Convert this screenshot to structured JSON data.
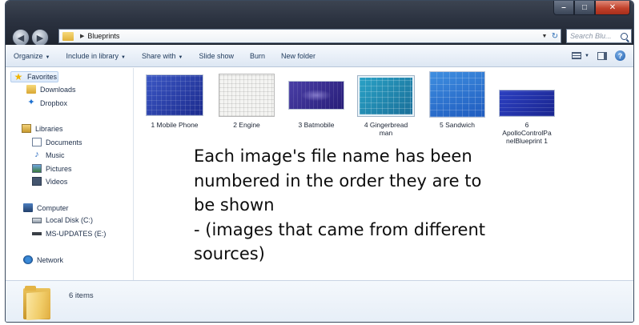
{
  "window": {
    "buttons": {
      "minimize": "–",
      "maximize": "□",
      "close": "✕"
    }
  },
  "address_bar": {
    "location": "Blueprints",
    "search_placeholder": "Search Blu..."
  },
  "nav_buttons": {
    "back": "◀",
    "forward": "▶"
  },
  "command_bar": {
    "organize": "Organize",
    "include_in_library": "Include in library",
    "share_with": "Share with",
    "slide_show": "Slide show",
    "burn": "Burn",
    "new_folder": "New folder",
    "help": "?"
  },
  "navigation": {
    "favorites": "Favorites",
    "downloads": "Downloads",
    "dropbox": "Dropbox",
    "libraries": "Libraries",
    "documents": "Documents",
    "music": "Music",
    "pictures": "Pictures",
    "videos": "Videos",
    "computer": "Computer",
    "local_disk": "Local Disk (C:)",
    "ms_updates": "MS-UPDATES (E:)",
    "network": "Network"
  },
  "files": [
    {
      "name": "1 Mobile Phone"
    },
    {
      "name": "2 Engine"
    },
    {
      "name": "3 Batmobile"
    },
    {
      "name": "4 Gingerbread\nman"
    },
    {
      "name": "5 Sandwich"
    },
    {
      "name": "6\nApolloControlPa\nnelBlueprint 1"
    }
  ],
  "annotation": "Each image's file name has been\nnumbered in the order they are to\nbe shown\n - (images that came from different\nsources)",
  "details_pane": {
    "item_count": "6 items"
  },
  "colors": {
    "window_frame": "#2b3240",
    "command_bar": "#dde7f3",
    "selection": "#dbe9f9"
  }
}
